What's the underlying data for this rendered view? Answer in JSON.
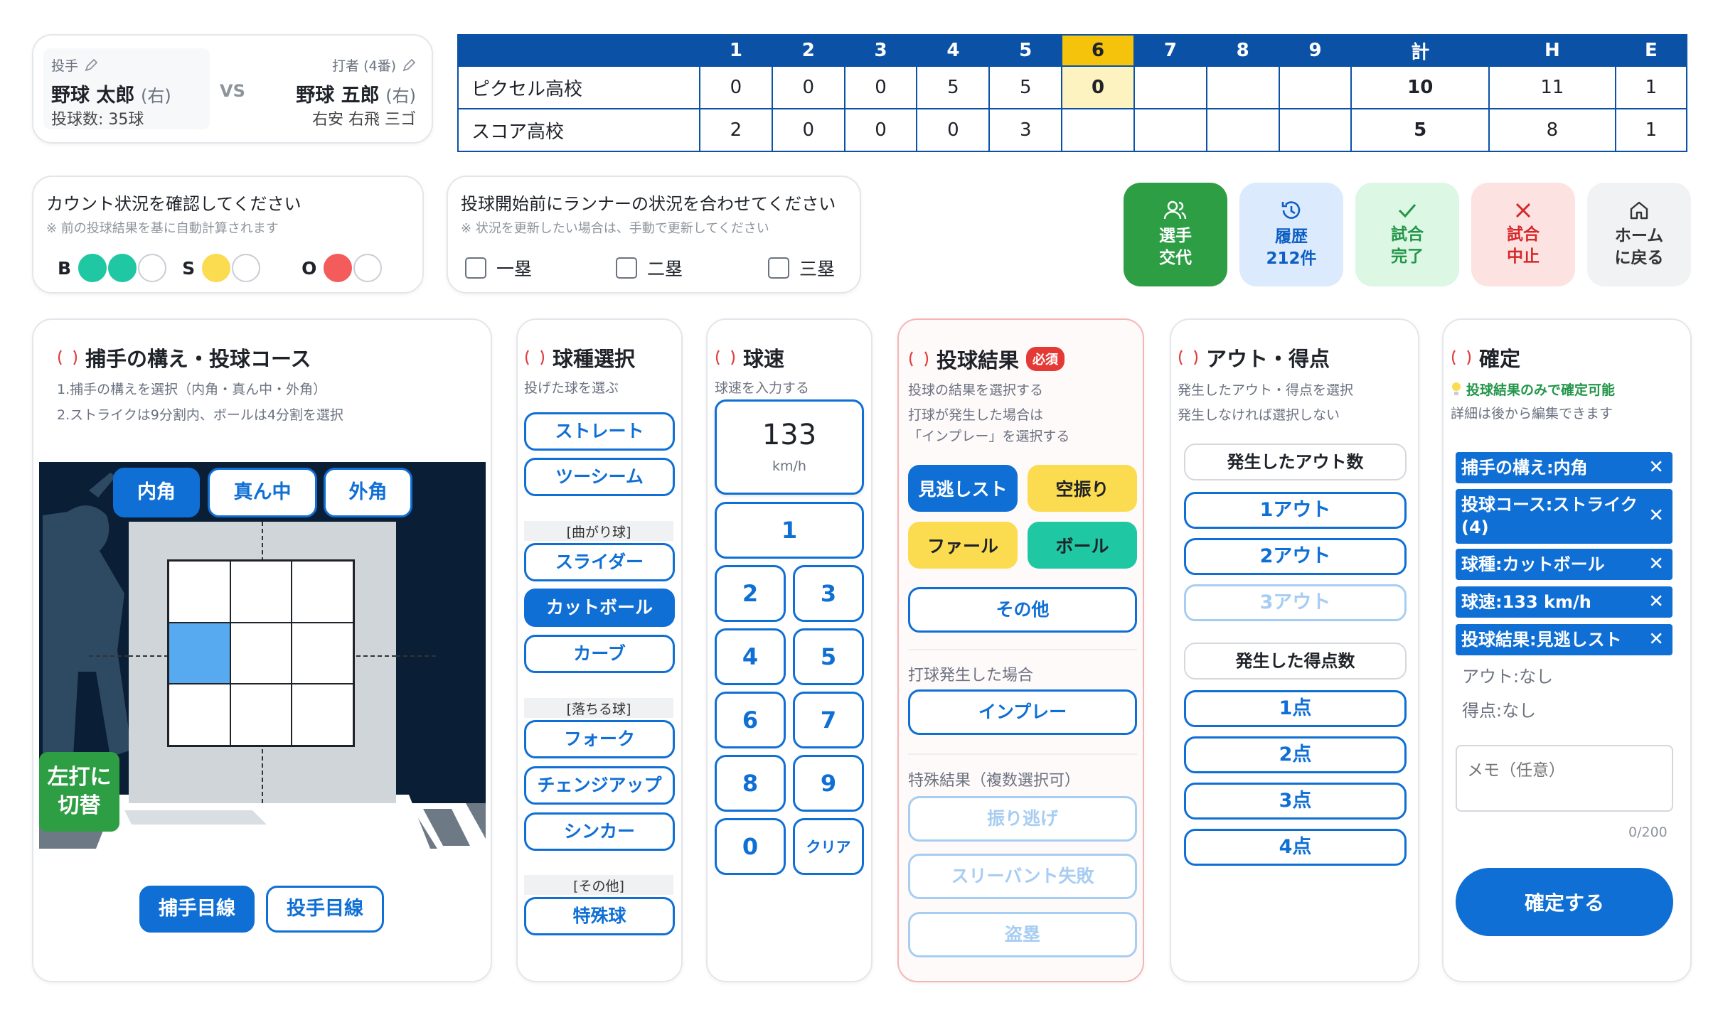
{
  "matchup": {
    "pitcher_label": "投手",
    "pitcher_name": "野球 太郎",
    "pitcher_hand": "(右)",
    "pitch_count": "投球数: 35球",
    "vs": "VS",
    "batter_label": "打者 (4番)",
    "batter_name": "野球 五郎",
    "batter_hand": "(右)",
    "batter_history": "右安 右飛 三ゴ"
  },
  "scoreboard": {
    "headers": [
      "",
      "1",
      "2",
      "3",
      "4",
      "5",
      "6",
      "7",
      "8",
      "9",
      "計",
      "H",
      "E"
    ],
    "current_inning": "6",
    "rows": [
      {
        "team": "ピクセル高校",
        "cells": [
          "0",
          "0",
          "0",
          "5",
          "5",
          "0",
          "",
          "",
          "",
          "10",
          "11",
          "1"
        ]
      },
      {
        "team": "スコア高校",
        "cells": [
          "2",
          "0",
          "0",
          "0",
          "3",
          "",
          "",
          "",
          "",
          "5",
          "8",
          "1"
        ]
      }
    ]
  },
  "count": {
    "title": "カウント状況を確認してください",
    "note": "※ 前の投球結果を基に自動計算されます",
    "b_label": "B",
    "s_label": "S",
    "o_label": "O",
    "balls": 2,
    "strikes": 1,
    "outs": 1,
    "colors": {
      "ball": "#1fc7a3",
      "strike": "#fbdb4f",
      "out": "#f45b5b"
    }
  },
  "runners": {
    "title": "投球開始前にランナーの状況を合わせてください",
    "note": "※ 状況を更新したい場合は、手動で更新してください",
    "first": "一塁",
    "second": "二塁",
    "third": "三塁"
  },
  "actions": {
    "substitute": "選手\n交代",
    "history_l1": "履歴",
    "history_l2": "212件",
    "complete_l1": "試合",
    "complete_l2": "完了",
    "cancel_l1": "試合",
    "cancel_l2": "中止",
    "home_l1": "ホーム",
    "home_l2": "に戻る",
    "sub_l1": "選手",
    "sub_l2": "交代"
  },
  "catcher": {
    "title": "捕手の構え・投球コース",
    "hint1": "1.捕手の構えを選択（内角・真ん中・外角）",
    "hint2": "2.ストライクは9分割内、ボールは4分割を選択",
    "inside": "内角",
    "middle": "真ん中",
    "outside": "外角",
    "switch_l1": "左打に",
    "switch_l2": "切替",
    "catcher_view": "捕手目線",
    "pitcher_view": "投手目線",
    "selected_zone": 4
  },
  "pitch_type": {
    "title": "球種選択",
    "subtitle": "投げた球を選ぶ",
    "straight": "ストレート",
    "twoseam": "ツーシーム",
    "cat_break": "[曲がり球]",
    "slider": "スライダー",
    "cutter": "カットボール",
    "curve": "カーブ",
    "cat_drop": "[落ちる球]",
    "fork": "フォーク",
    "changeup": "チェンジアップ",
    "sinker": "シンカー",
    "cat_other": "[その他]",
    "special": "特殊球"
  },
  "speed": {
    "title": "球速",
    "subtitle": "球速を入力する",
    "value": "133",
    "unit": "km/h",
    "keys": [
      "1",
      "2",
      "3",
      "4",
      "5",
      "6",
      "7",
      "8",
      "9",
      "0"
    ],
    "clear": "クリア"
  },
  "result": {
    "title": "投球結果",
    "required": "必須",
    "sub1": "投球の結果を選択する",
    "sub2": "打球が発生した場合は",
    "sub3": "「インプレー」を選択する",
    "looking": "見逃しスト",
    "swinging": "空振り",
    "foul": "ファール",
    "ball": "ボール",
    "other": "その他",
    "batted_label": "打球発生した場合",
    "inplay": "インプレー",
    "special_label": "特殊結果（複数選択可）",
    "swing_escape": "振り逃げ",
    "bunt_fail": "スリーバント失敗",
    "steal": "盗塁"
  },
  "outs_runs": {
    "title": "アウト・得点",
    "sub1": "発生したアウト・得点を選択",
    "sub2": "発生しなければ選択しない",
    "outs_label": "発生したアウト数",
    "out1": "1アウト",
    "out2": "2アウト",
    "out3": "3アウト",
    "runs_label": "発生した得点数",
    "run1": "1点",
    "run2": "2点",
    "run3": "3点",
    "run4": "4点"
  },
  "confirm": {
    "title": "確定",
    "tip": "投球結果のみで確定可能",
    "sub": "詳細は後から編集できます",
    "chips": [
      "捕手の構え:内角",
      "投球コース:ストライク(4)",
      "球種:カットボール",
      "球速:133 km/h",
      "投球結果:見逃しスト"
    ],
    "outs_none": "アウト:なし",
    "runs_none": "得点:なし",
    "memo_placeholder": "メモ（任意）",
    "counter": "0/200",
    "submit": "確定する"
  }
}
